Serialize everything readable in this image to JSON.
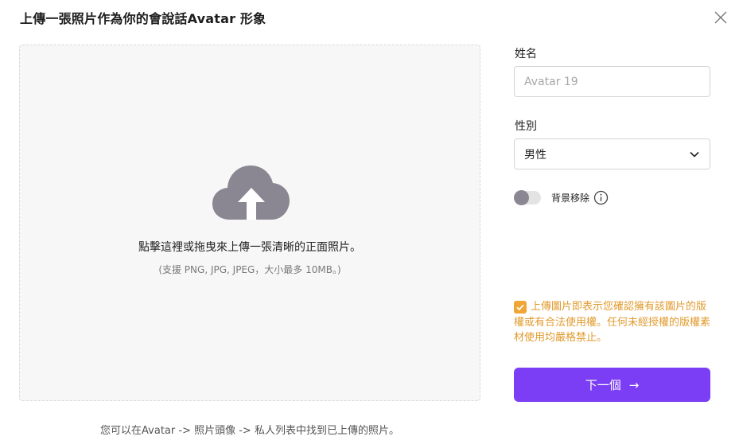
{
  "dialog": {
    "title": "上傳一張照片作為你的會說話Avatar 形象"
  },
  "upload": {
    "main_text": "點擊這裡或拖曳來上傳一張清晰的正面照片。",
    "sub_text": "(支援 PNG, JPG, JPEG，大小最多 10MB。)",
    "icon": "cloud-upload-icon"
  },
  "footer_hint": "您可以在Avatar -> 照片頭像 -> 私人列表中找到已上傳的照片。",
  "form": {
    "name_label": "姓名",
    "name_placeholder": "Avatar 19",
    "gender_label": "性別",
    "gender_value": "男性",
    "bg_remove_label": "背景移除",
    "bg_remove_on": false,
    "consent_text": "上傳圖片即表示您確認擁有該圖片的版權或有合法使用權。任何未經授權的版權素材使用均嚴格禁止。",
    "consent_checked": true,
    "next_label": "下一個",
    "next_arrow": "→"
  },
  "colors": {
    "accent": "#7b3ef5",
    "consent": "#e09a2c",
    "checkbox": "#f0a535",
    "cloud_icon": "#8a8792"
  }
}
